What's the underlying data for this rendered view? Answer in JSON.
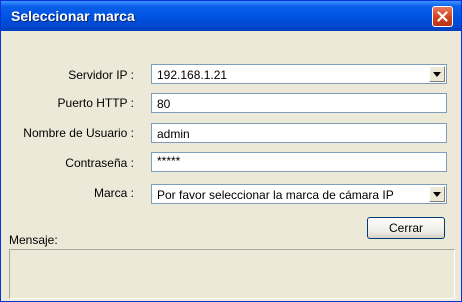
{
  "window": {
    "title": "Seleccionar marca"
  },
  "form": {
    "server_ip": {
      "label": "Servidor IP :",
      "value": "192.168.1.21"
    },
    "http_port": {
      "label": "Puerto HTTP :",
      "value": "80"
    },
    "username": {
      "label": "Nombre de Usuario :",
      "value": "admin"
    },
    "password": {
      "label": "Contraseña :",
      "value": "*****"
    },
    "brand": {
      "label": "Marca :",
      "value": "Por favor seleccionar la marca de cámara IP"
    }
  },
  "buttons": {
    "close_label": "Cerrar"
  },
  "message": {
    "label": "Mensaje:",
    "text": ""
  },
  "colors": {
    "titlebar": "#0054e3",
    "window_bg": "#ece9d8",
    "close_button": "#d0441f"
  },
  "icons": {
    "close": "close-icon",
    "dropdown": "chevron-down-icon"
  }
}
